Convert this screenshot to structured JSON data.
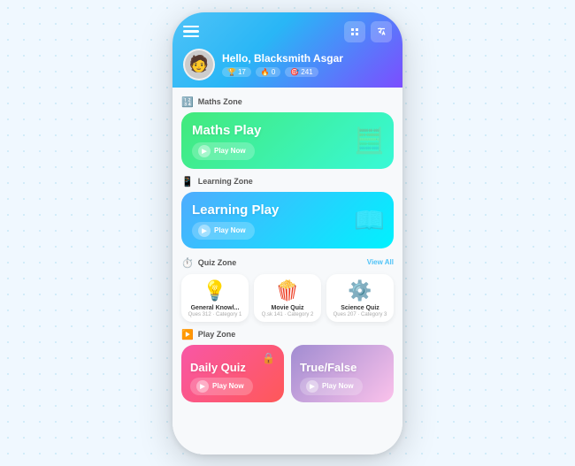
{
  "background": {
    "dot_color": "#a0d8ef"
  },
  "header": {
    "greeting": "Hello, Blacksmith Asgar",
    "stats": [
      {
        "icon": "🏆",
        "value": "17"
      },
      {
        "icon": "🔥",
        "value": "0"
      },
      {
        "icon": "🎯",
        "value": "241"
      }
    ],
    "hamburger_label": "Menu",
    "icon1_label": "Notifications",
    "icon2_label": "Translate"
  },
  "zones": {
    "maths": {
      "label": "Maths Zone",
      "card": {
        "title": "Maths Play",
        "button": "Play Now",
        "deco": "🧮"
      }
    },
    "learning": {
      "label": "Learning Zone",
      "card": {
        "title": "Learning Play",
        "button": "Play Now",
        "deco": "📖"
      }
    },
    "quiz": {
      "label": "Quiz Zone",
      "view_all": "View All",
      "cards": [
        {
          "title": "General Knowl...",
          "meta": "Ques 312 · Category 1",
          "emoji": "💡"
        },
        {
          "title": "Movie Quiz",
          "meta": "Q.sk 141 · Category 2",
          "emoji": "🍿"
        },
        {
          "title": "Science Quiz",
          "meta": "Ques 207 · Category 3",
          "emoji": "⚙️"
        }
      ]
    },
    "play": {
      "label": "Play Zone",
      "cards": [
        {
          "title": "Daily Quiz",
          "button": "Play Now",
          "has_lock": true
        },
        {
          "title": "True/False",
          "button": "Play Now",
          "has_lock": false
        }
      ]
    }
  },
  "avatar_emoji": "🧑"
}
